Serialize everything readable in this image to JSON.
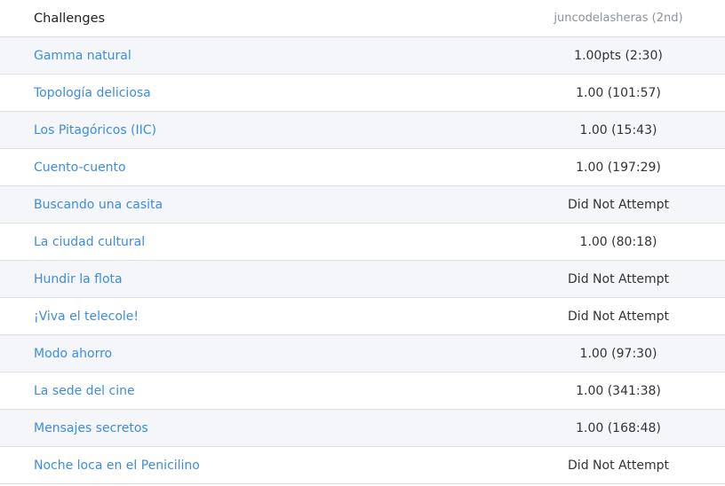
{
  "header": {
    "title": "Challenges",
    "user": "juncodelasheras (2nd)"
  },
  "rows": [
    {
      "name": "Gamma natural",
      "score": "1.00pts (2:30)"
    },
    {
      "name": "Topología deliciosa",
      "score": "1.00 (101:57)"
    },
    {
      "name": "Los Pitagóricos (IIC)",
      "score": "1.00 (15:43)"
    },
    {
      "name": "Cuento-cuento",
      "score": "1.00 (197:29)"
    },
    {
      "name": "Buscando una casita",
      "score": "Did Not Attempt"
    },
    {
      "name": "La ciudad cultural",
      "score": "1.00 (80:18)"
    },
    {
      "name": "Hundir la flota",
      "score": "Did Not Attempt"
    },
    {
      "name": "¡Viva el telecole!",
      "score": "Did Not Attempt"
    },
    {
      "name": "Modo ahorro",
      "score": "1.00 (97:30)"
    },
    {
      "name": "La sede del cine",
      "score": "1.00 (341:38)"
    },
    {
      "name": "Mensajes secretos",
      "score": "1.00 (168:48)"
    },
    {
      "name": "Noche loca en el Penicilino",
      "score": "Did Not Attempt"
    }
  ],
  "colors": {
    "link": "#3d8ce0",
    "stripe": "#f4f6fa",
    "border": "#dcdee2"
  }
}
